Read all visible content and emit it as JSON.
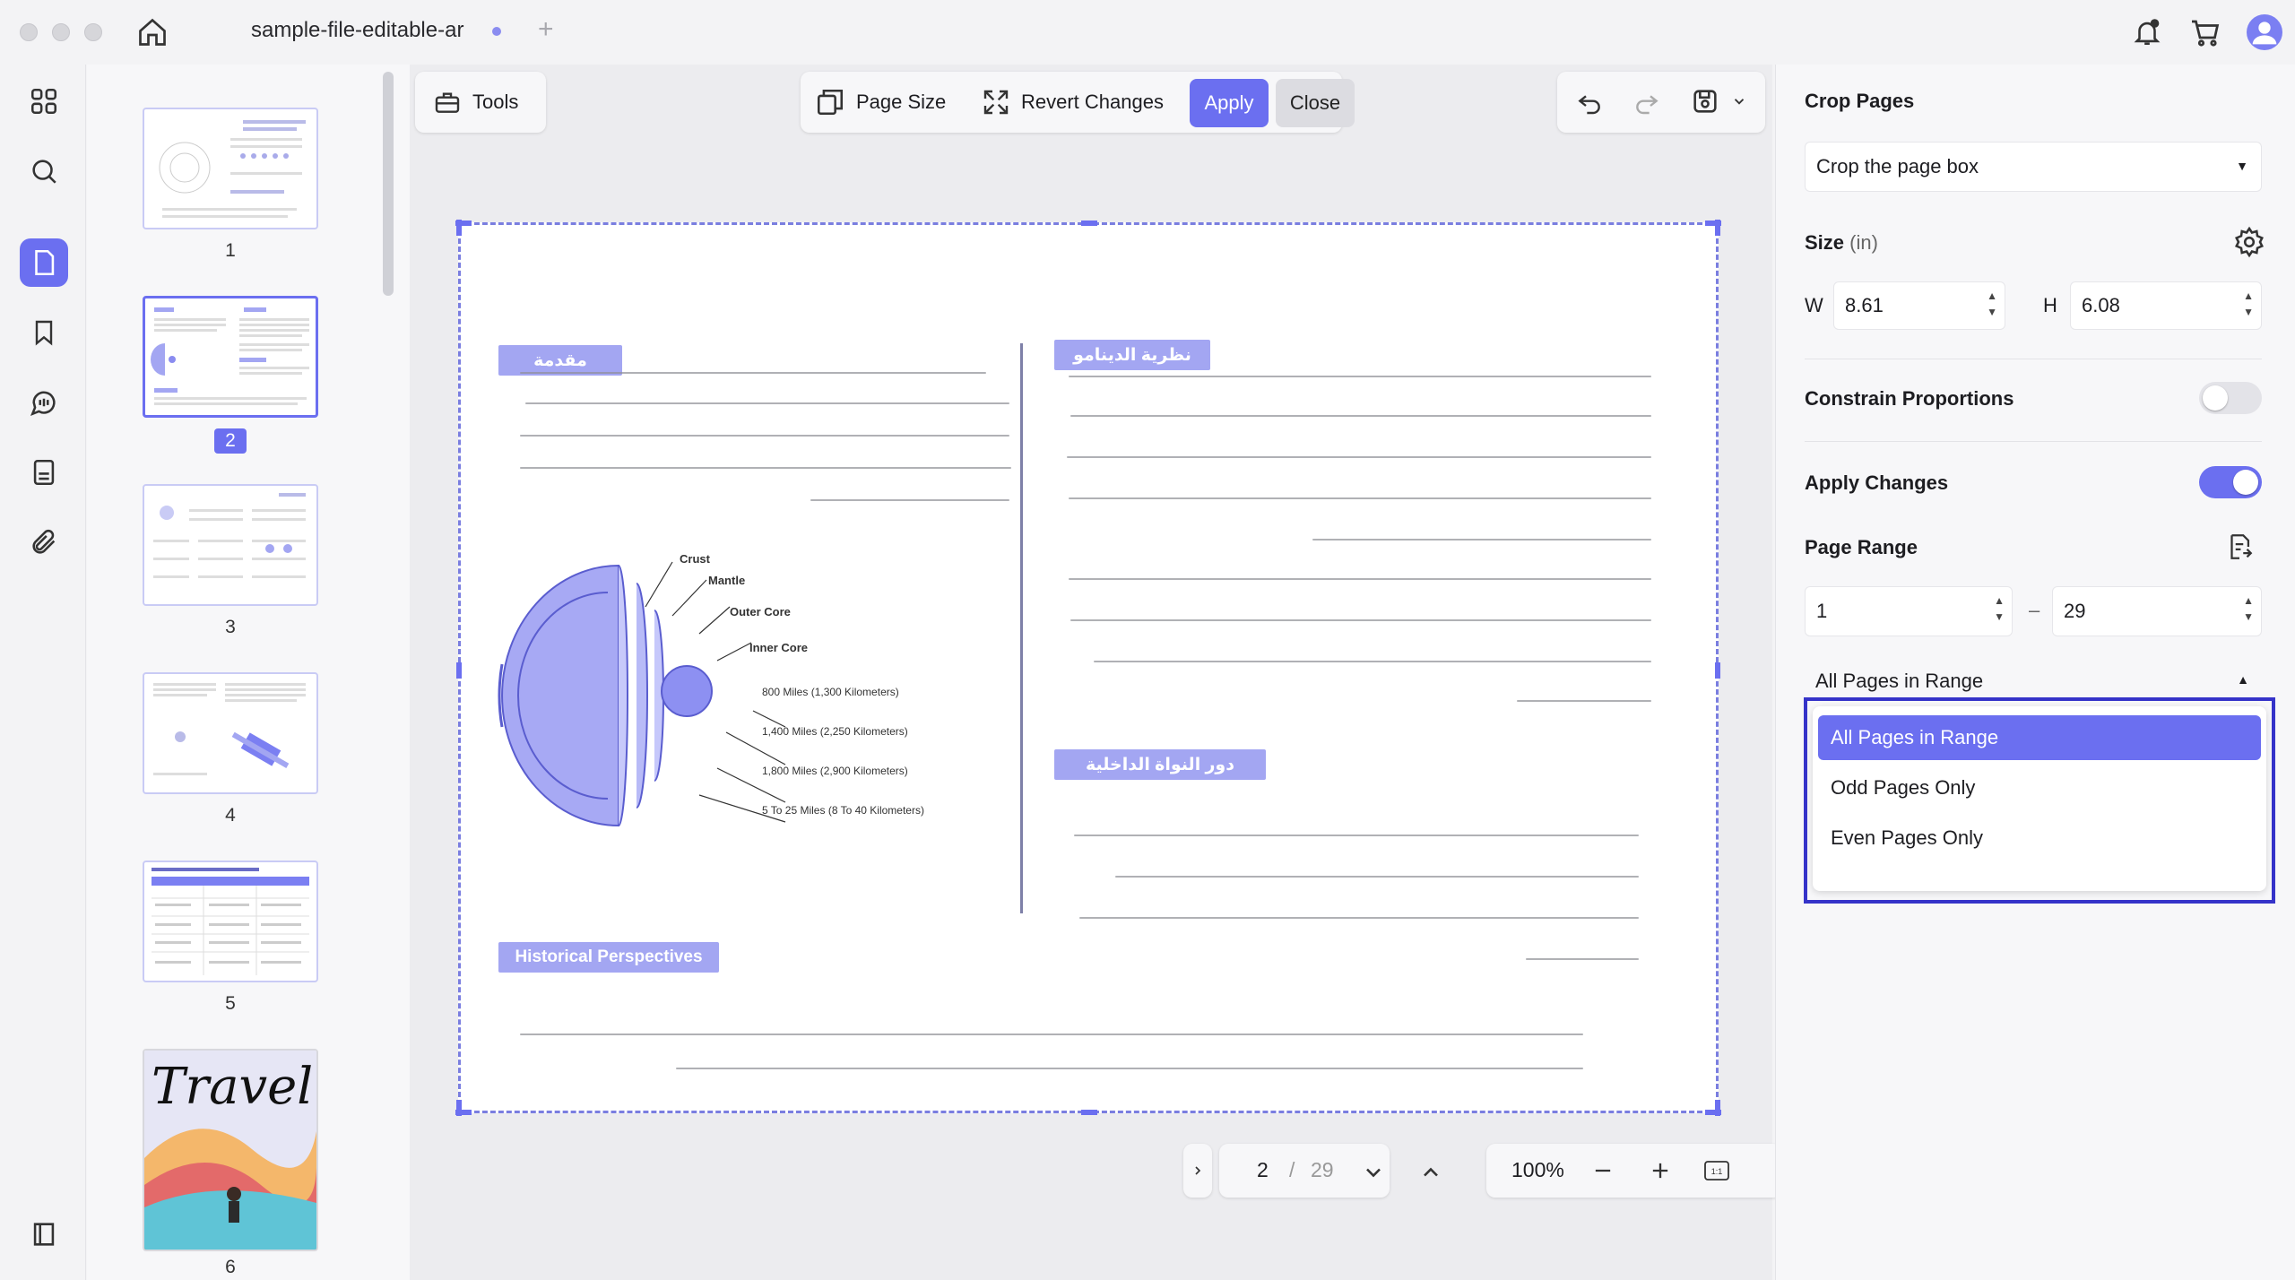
{
  "titlebar": {
    "tab_title": "sample-file-editable-ar"
  },
  "toolbar": {
    "tools_label": "Tools",
    "page_size_label": "Page Size",
    "revert_label": "Revert Changes",
    "apply_label": "Apply",
    "close_label": "Close"
  },
  "thumbnails": [
    {
      "number": "1"
    },
    {
      "number": "2"
    },
    {
      "number": "3"
    },
    {
      "number": "4"
    },
    {
      "number": "5"
    },
    {
      "number": "6"
    }
  ],
  "thumb_cover_text": "Travel",
  "page": {
    "heading_intro": "مقدمة",
    "heading_dynamo": "نظرية الدينامو",
    "heading_core": "دور النواة الداخلية",
    "heading_history": "Historical Perspectives",
    "diagram": {
      "crust": "Crust",
      "mantle": "Mantle",
      "outer_core": "Outer Core",
      "inner_core": "Inner Core",
      "d1": "800 Miles (1,300 Kilometers)",
      "d2": "1,400 Miles (2,250 Kilometers)",
      "d3": "1,800 Miles (2,900 Kilometers)",
      "d4": "5 To 25 Miles (8 To 40 Kilometers)"
    }
  },
  "nav": {
    "current_page": "2",
    "separator": "/",
    "total_pages": "29",
    "zoom": "100%"
  },
  "right_panel": {
    "title": "Crop Pages",
    "crop_mode": "Crop the page box",
    "size_label": "Size",
    "size_unit": "(in)",
    "w_label": "W",
    "w_value": "8.61",
    "h_label": "H",
    "h_value": "6.08",
    "constrain_label": "Constrain Proportions",
    "constrain_on": false,
    "apply_changes_label": "Apply Changes",
    "apply_changes_on": true,
    "page_range_label": "Page Range",
    "range_from": "1",
    "range_dash": "–",
    "range_to": "29",
    "range_mode": "All Pages in Range",
    "range_options": [
      "All Pages in Range",
      "Odd Pages Only",
      "Even Pages Only"
    ]
  },
  "colors": {
    "accent": "#6b6ff0",
    "highlight_border": "#3533c9"
  }
}
